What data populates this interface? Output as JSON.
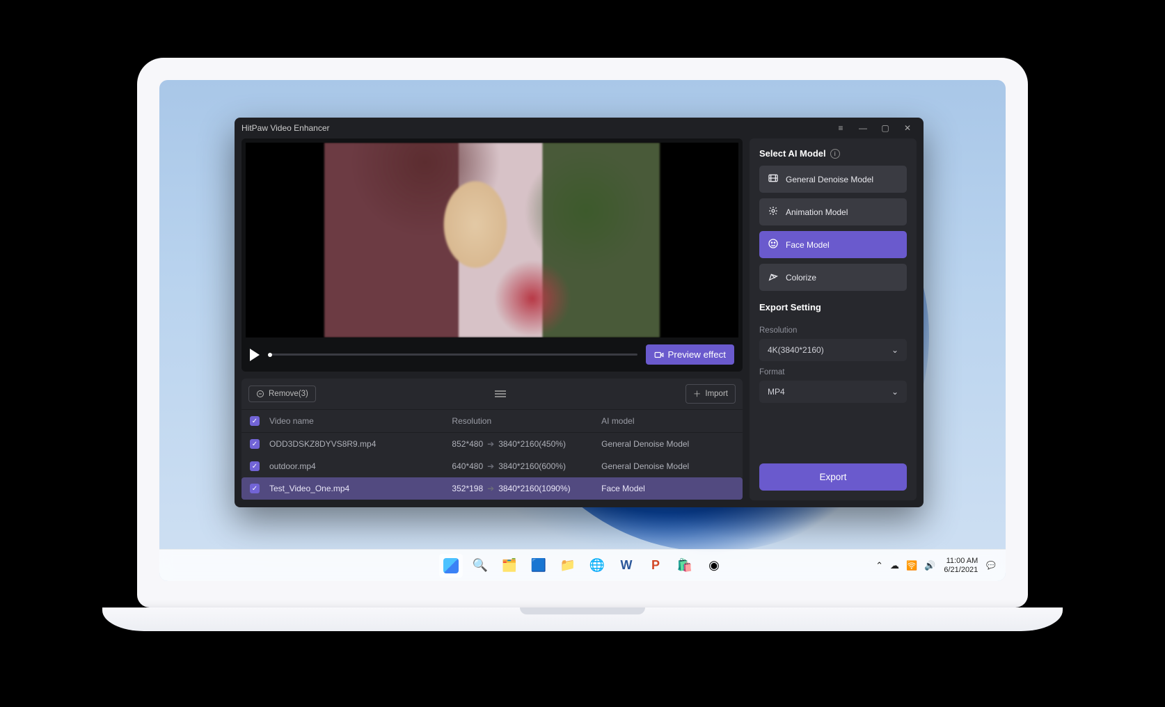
{
  "app": {
    "title": "HitPaw Video Enhancer",
    "preview_button": "Preview effect",
    "queue": {
      "remove_label": "Remove(3)",
      "import_label": "Import",
      "headers": {
        "name": "Video name",
        "resolution": "Resolution",
        "model": "AI model"
      },
      "rows": [
        {
          "name": "ODD3DSKZ8DYVS8R9.mp4",
          "src": "852*480",
          "dst": "3840*2160(450%)",
          "model": "General Denoise Model",
          "selected": false
        },
        {
          "name": "outdoor.mp4",
          "src": "640*480",
          "dst": "3840*2160(600%)",
          "model": "General Denoise Model",
          "selected": false
        },
        {
          "name": "Test_Video_One.mp4",
          "src": "352*198",
          "dst": "3840*2160(1090%)",
          "model": "Face Model",
          "selected": true
        }
      ]
    }
  },
  "panel": {
    "select_model_title": "Select AI Model",
    "models": [
      {
        "label": "General Denoise Model",
        "icon": "film",
        "selected": false
      },
      {
        "label": "Animation Model",
        "icon": "motion",
        "selected": false
      },
      {
        "label": "Face Model",
        "icon": "face",
        "selected": true
      },
      {
        "label": "Colorize",
        "icon": "palette",
        "selected": false
      }
    ],
    "export_title": "Export Setting",
    "resolution_label": "Resolution",
    "resolution_value": "4K(3840*2160)",
    "format_label": "Format",
    "format_value": "MP4",
    "export_button": "Export"
  },
  "taskbar": {
    "time": "11:00 AM",
    "date": "6/21/2021"
  }
}
